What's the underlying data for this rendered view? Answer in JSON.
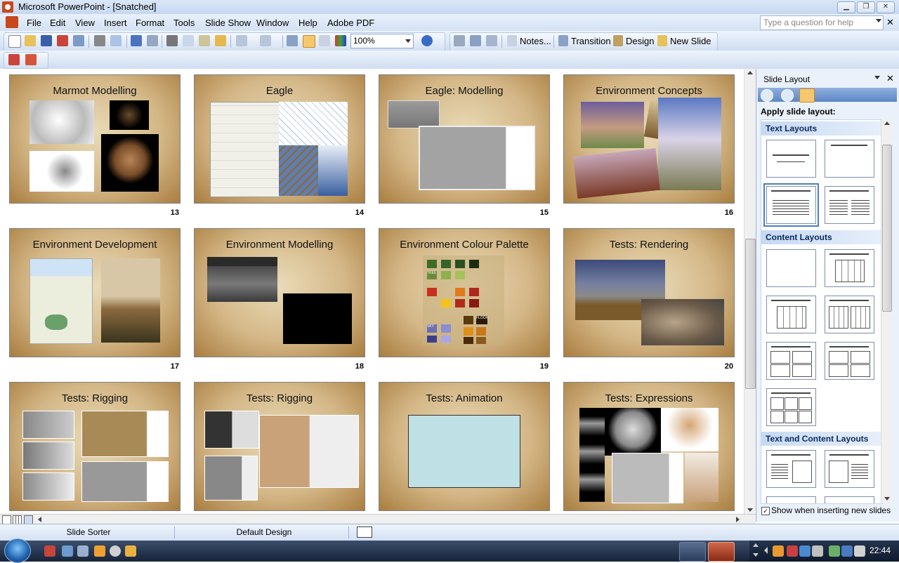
{
  "window": {
    "title": "Microsoft PowerPoint - [Snatched]",
    "help_placeholder": "Type a question for help"
  },
  "menu": {
    "items": [
      "File",
      "Edit",
      "View",
      "Insert",
      "Format",
      "Tools",
      "Slide Show",
      "Window",
      "Help",
      "Adobe PDF"
    ]
  },
  "toolbar": {
    "zoom": "100%",
    "notes_label": "Notes...",
    "transition_label": "Transition",
    "design_label": "Design",
    "new_slide_label": "New Slide"
  },
  "slides": [
    {
      "num": "13",
      "title": "Marmot Modelling"
    },
    {
      "num": "14",
      "title": "Eagle"
    },
    {
      "num": "15",
      "title": "Eagle: Modelling"
    },
    {
      "num": "16",
      "title": "Environment Concepts"
    },
    {
      "num": "17",
      "title": "Environment Development"
    },
    {
      "num": "18",
      "title": "Environment Modelling"
    },
    {
      "num": "19",
      "title": "Environment Colour Palette"
    },
    {
      "num": "20",
      "title": "Tests: Rendering"
    },
    {
      "num": "",
      "title": "Tests: Rigging"
    },
    {
      "num": "",
      "title": "Tests: Rigging"
    },
    {
      "num": "",
      "title": "Tests: Animation"
    },
    {
      "num": "",
      "title": "Tests: Expressions"
    }
  ],
  "palette_labels": {
    "tree": "TREE",
    "sky": "SKY",
    "floor": "FLOOR"
  },
  "taskpane": {
    "title": "Slide Layout",
    "apply_label": "Apply slide layout:",
    "categories": {
      "text": "Text Layouts",
      "content": "Content Layouts",
      "text_content": "Text and Content Layouts"
    },
    "show_when": "Show when inserting new slides",
    "show_when_checked": "✓"
  },
  "status": {
    "view": "Slide Sorter",
    "design": "Default Design"
  },
  "clock": "22:44",
  "colors": {
    "accent": "#4d7cc8",
    "slide_bg": "#d4b787"
  }
}
